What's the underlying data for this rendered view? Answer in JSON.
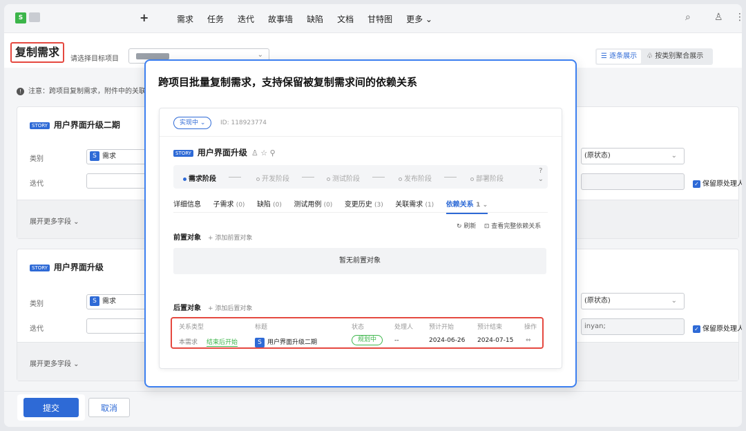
{
  "nav": {
    "logo_letter": "S",
    "plus": "+",
    "items": [
      "需求",
      "任务",
      "迭代",
      "故事墙",
      "缺陷",
      "文档",
      "甘特图"
    ],
    "more": "更多 ⌄",
    "search_icon": "⌕",
    "user_icon": "♙",
    "kebab_icon": "⋮"
  },
  "header": {
    "title": "复制需求",
    "target_label": "请选择目标项目",
    "view_list": "☰ 逐条展示",
    "view_group": "♧ 按类别聚合展示"
  },
  "notice": "注意：跨项目复制需求，附件中的关联",
  "cards": [
    {
      "tag": "STORY",
      "name": "用户界面升级二期",
      "type_label": "类别",
      "type_value": "需求",
      "iteration_label": "迭代",
      "status_value": "(原状态)",
      "keep_owner": "保留原处理人",
      "right_value": "",
      "expand": "展开更多字段 ⌄"
    },
    {
      "tag": "STORY",
      "name": "用户界面升级",
      "type_label": "类别",
      "type_value": "需求",
      "iteration_label": "迭代",
      "status_value": "(原状态)",
      "keep_owner": "保留原处理人",
      "right_value": "inyan;",
      "expand": "展开更多字段 ⌄"
    }
  ],
  "buttons": {
    "submit": "提交",
    "cancel": "取消"
  },
  "dialog": {
    "title": "跨项目批量复制需求，支持保留被复制需求间的依赖关系",
    "status": "实现中 ⌄",
    "id_text": "ID: 118923774",
    "story_tag": "STORY",
    "story_name": "用户界面升级",
    "story_icons": "♙  ☆  ⚲",
    "stages": [
      "需求阶段",
      "开发阶段",
      "测试阶段",
      "发布阶段",
      "部署阶段"
    ],
    "stage_help": "?\n⌄",
    "tabs": [
      {
        "label": "详细信息",
        "count": ""
      },
      {
        "label": "子需求",
        "count": "(0)"
      },
      {
        "label": "缺陷",
        "count": "(0)"
      },
      {
        "label": "测试用例",
        "count": "(0)"
      },
      {
        "label": "变更历史",
        "count": "(3)"
      },
      {
        "label": "关联需求",
        "count": "(1)"
      },
      {
        "label": "依赖关系",
        "count": "1 ⌄"
      }
    ],
    "refresh": "↻ 刷新    ⊡ 查看完整依赖关系",
    "pre_title": "前置对象",
    "pre_add": "+ 添加前置对象",
    "pre_empty": "暂无前置对象",
    "post_title": "后置对象",
    "post_add": "+ 添加后置对象",
    "columns": [
      "关系类型",
      "标题",
      "状态",
      "处理人",
      "预计开始",
      "预计结束",
      "操作"
    ],
    "row": {
      "type": "本需求",
      "relation": "结束后开始",
      "title": "用户界面升级二期",
      "status": "规划中",
      "owner": "--",
      "start": "2024-06-26",
      "end": "2024-07-15",
      "op_icon": "⇔"
    }
  }
}
